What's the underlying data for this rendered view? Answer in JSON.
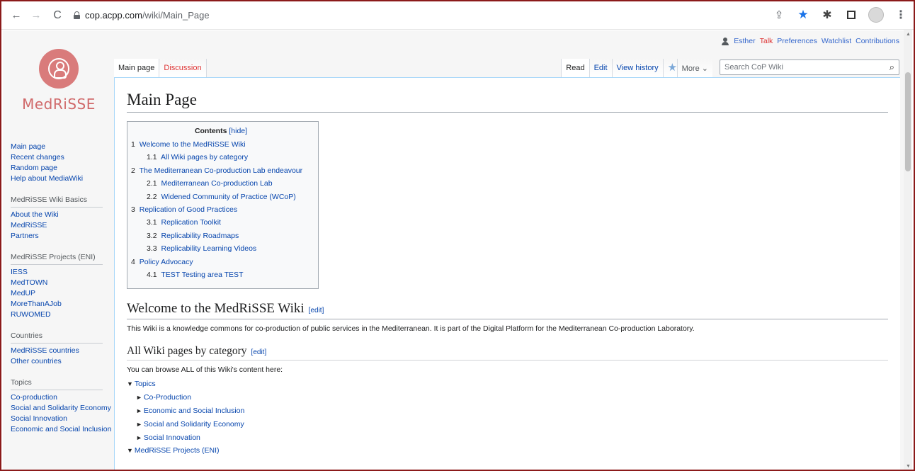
{
  "browser": {
    "url_domain": "cop.acpp.com",
    "url_path": "/wiki/Main_Page",
    "back_glyph": "←",
    "fwd_glyph": "→",
    "reload_glyph": "C",
    "share_glyph": "⇪",
    "star_glyph": "★",
    "ext_glyph": "✱",
    "menu_glyph": "⋮",
    "accent": "#1a73e8"
  },
  "personal": {
    "user": "Esther",
    "talk": "Talk",
    "preferences": "Preferences",
    "watchlist": "Watchlist",
    "contributions": "Contributions"
  },
  "logo": {
    "text": "MedRiSSE",
    "color": "#d97b7b"
  },
  "tabs": {
    "main_page": "Main page",
    "discussion": "Discussion",
    "read": "Read",
    "edit": "Edit",
    "view_history": "View history",
    "watch_star": "★",
    "more": "More ⌄"
  },
  "search": {
    "placeholder": "Search CoP Wiki",
    "icon": "⌕"
  },
  "sidebar": {
    "nav": [
      "Main page",
      "Recent changes",
      "Random page",
      "Help about MediaWiki"
    ],
    "basics": {
      "title": "MedRiSSE Wiki Basics",
      "items": [
        "About the Wiki",
        "MedRiSSE",
        "Partners"
      ]
    },
    "projects": {
      "title": "MedRiSSE Projects (ENI)",
      "items": [
        "IESS",
        "MedTOWN",
        "MedUP",
        "MoreThanAJob",
        "RUWOMED"
      ]
    },
    "countries": {
      "title": "Countries",
      "items": [
        "MedRiSSE countries",
        "Other countries"
      ]
    },
    "topics": {
      "title": "Topics",
      "items": [
        "Co-production",
        "Social and Solidarity Economy",
        "Social Innovation",
        "Economic and Social Inclusion"
      ]
    }
  },
  "content": {
    "title": "Main Page",
    "toc": {
      "title": "Contents",
      "hide": "[hide]",
      "items": [
        {
          "num": "1",
          "text": "Welcome to the MedRiSSE Wiki",
          "level": 1
        },
        {
          "num": "1.1",
          "text": "All Wiki pages by category",
          "level": 2
        },
        {
          "num": "2",
          "text": "The Mediterranean Co-production Lab endeavour",
          "level": 1
        },
        {
          "num": "2.1",
          "text": "Mediterranean Co-production Lab",
          "level": 2
        },
        {
          "num": "2.2",
          "text": "Widened Community of Practice (WCoP)",
          "level": 2
        },
        {
          "num": "3",
          "text": "Replication of Good Practices",
          "level": 1
        },
        {
          "num": "3.1",
          "text": "Replication Toolkit",
          "level": 2
        },
        {
          "num": "3.2",
          "text": "Replicability Roadmaps",
          "level": 2
        },
        {
          "num": "3.3",
          "text": "Replicability Learning Videos",
          "level": 2
        },
        {
          "num": "4",
          "text": "Policy Advocacy",
          "level": 1
        },
        {
          "num": "4.1",
          "text": "TEST Testing area TEST",
          "level": 2
        }
      ]
    },
    "welcome": {
      "heading": "Welcome to the MedRiSSE Wiki",
      "edit": "[edit]",
      "text": "This Wiki is a knowledge commons for co-production of public services in the Mediterranean. It is part of the Digital Platform for the Mediterranean Co-production Laboratory."
    },
    "category": {
      "heading": "All Wiki pages by category",
      "edit": "[edit]",
      "text": "You can browse ALL of this Wiki's content here:",
      "tree": [
        {
          "text": "Topics",
          "level": 1,
          "open": true
        },
        {
          "text": "Co-Production",
          "level": 2,
          "open": false
        },
        {
          "text": "Economic and Social Inclusion",
          "level": 2,
          "open": false
        },
        {
          "text": "Social and Solidarity Economy",
          "level": 2,
          "open": false
        },
        {
          "text": "Social Innovation",
          "level": 2,
          "open": false
        },
        {
          "text": "MedRiSSE Projects (ENI)",
          "level": 1,
          "open": true
        }
      ]
    }
  }
}
